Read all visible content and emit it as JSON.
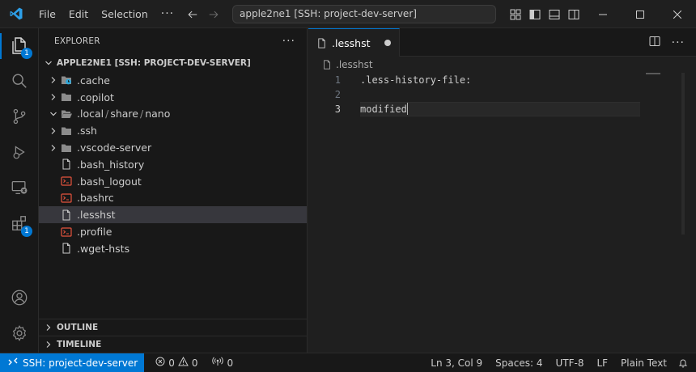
{
  "title_bar": {
    "menus": [
      "File",
      "Edit",
      "Selection"
    ],
    "more": "···",
    "command_center": "apple2ne1 [SSH: project-dev-server]"
  },
  "activity_bar": {
    "explorer_badge": "1",
    "extensions_badge": "1"
  },
  "sidebar": {
    "title": "EXPLORER",
    "more": "···",
    "folder_title": "APPLE2NE1 [SSH: PROJECT-DEV-SERVER]",
    "items": [
      {
        "name": ".cache",
        "type": "folder",
        "icon": "folder-icon-cache"
      },
      {
        "name": ".copilot",
        "type": "folder",
        "icon": "folder-icon"
      },
      {
        "name": ".local",
        "type": "folder-open",
        "path": [
          ".local",
          "share",
          "nano"
        ]
      },
      {
        "name": ".ssh",
        "type": "folder",
        "icon": "folder-icon"
      },
      {
        "name": ".vscode-server",
        "type": "folder",
        "icon": "folder-icon"
      },
      {
        "name": ".bash_history",
        "type": "file",
        "icon": "file-icon"
      },
      {
        "name": ".bash_logout",
        "type": "shell",
        "icon": "shell-file-icon"
      },
      {
        "name": ".bashrc",
        "type": "shell",
        "icon": "shell-file-icon"
      },
      {
        "name": ".lesshst",
        "type": "file",
        "icon": "file-icon",
        "selected": true
      },
      {
        "name": ".profile",
        "type": "shell",
        "icon": "shell-file-icon"
      },
      {
        "name": ".wget-hsts",
        "type": "file",
        "icon": "file-icon"
      }
    ],
    "outline": "OUTLINE",
    "timeline": "TIMELINE"
  },
  "editor": {
    "tab_label": ".lesshst",
    "breadcrumb": ".lesshst",
    "lines": [
      {
        "number": "1",
        "text": ".less-history-file:"
      },
      {
        "number": "2",
        "text": ""
      },
      {
        "number": "3",
        "text": "modified"
      }
    ]
  },
  "status_bar": {
    "remote": "SSH: project-dev-server",
    "errors": "0",
    "warnings": "0",
    "ports": "0",
    "position": "Ln 3, Col 9",
    "spaces": "Spaces: 4",
    "encoding": "UTF-8",
    "eol": "LF",
    "language": "Plain Text"
  },
  "colors": {
    "accent": "#0078d4",
    "background": "#1f1f1f",
    "sidebar": "#181818",
    "selection": "#37373d",
    "shell_icon": "#e5533d",
    "cache_icon": "#2ea6d8"
  }
}
